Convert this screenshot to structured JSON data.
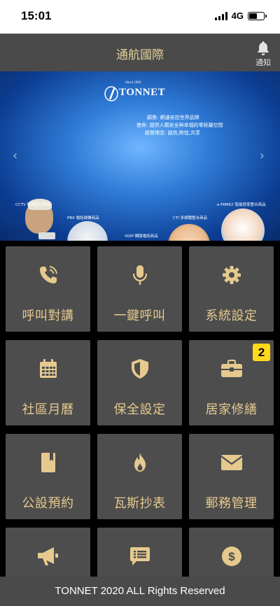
{
  "status_bar": {
    "time": "15:01",
    "network": "4G"
  },
  "header": {
    "title": "通航國際",
    "notify_label": "通知"
  },
  "banner": {
    "logo_since": "Since 1983",
    "logo_text": "TONNET",
    "lines": [
      "願景: 網通安控世界品牌",
      "使命: 提供人類安全與幸福的零距離空間",
      "經營理念: 誠信,熱忱,共享"
    ],
    "captions": [
      "CCTV 影像監控商品",
      "PBX 電話總機商品",
      "VOIP 網路電話商品",
      "CTI 多媒體整合商品",
      "e-FAMILY 智能居家整合商品"
    ]
  },
  "menu": [
    {
      "label": "呼叫對講",
      "icon": "phone-icon"
    },
    {
      "label": "一鍵呼叫",
      "icon": "microphone-icon"
    },
    {
      "label": "系統設定",
      "icon": "gear-icon"
    },
    {
      "label": "社區月曆",
      "icon": "calendar-icon"
    },
    {
      "label": "保全設定",
      "icon": "shield-icon"
    },
    {
      "label": "居家修繕",
      "icon": "toolbox-icon",
      "badge": "2"
    },
    {
      "label": "公設預約",
      "icon": "book-icon"
    },
    {
      "label": "瓦斯抄表",
      "icon": "fire-icon"
    },
    {
      "label": "郵務管理",
      "icon": "envelope-icon"
    },
    {
      "label": "",
      "icon": "megaphone-icon"
    },
    {
      "label": "",
      "icon": "message-icon"
    },
    {
      "label": "",
      "icon": "dollar-icon"
    }
  ],
  "footer": {
    "text": "TONNET 2020 ALL Rights Reserved"
  },
  "colors": {
    "accent": "#e5c98e",
    "tile": "#4d4d4d",
    "header": "#4a4a4a",
    "badge": "#ffd91a"
  }
}
